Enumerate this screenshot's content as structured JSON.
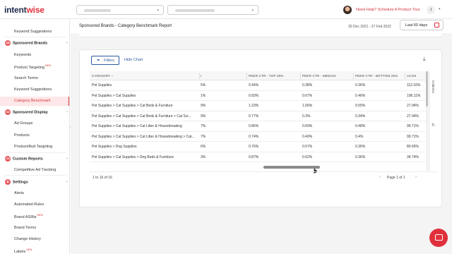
{
  "brand": {
    "logo_part1": "intent",
    "logo_part2": "wise"
  },
  "header": {
    "help_text": "Need Help? Schedule A Product Tour",
    "user_initial": "J",
    "colors": {
      "accent": "#e0303b",
      "link": "#2c5aa0"
    }
  },
  "sidebar": {
    "items": [
      {
        "label": "Keyword Suggestions"
      },
      {
        "section": "Sponsored Brands",
        "badge": "SB"
      },
      {
        "label": "Keywords"
      },
      {
        "label": "Product Targeting",
        "new": "NEW"
      },
      {
        "label": "Search Terms"
      },
      {
        "label": "Keyword Suggestions"
      },
      {
        "label": "Category Benchmark",
        "active": true
      },
      {
        "section": "Sponsored Display",
        "badge": "SD"
      },
      {
        "label": "Ad Groups"
      },
      {
        "label": "Products"
      },
      {
        "label": "Product/Aud Targeting"
      },
      {
        "section": "Custom Reports",
        "badge": "CR"
      },
      {
        "label": "Competitive Ad Tracking"
      },
      {
        "section": "Settings",
        "badge": "⚙"
      },
      {
        "label": "Alerts"
      },
      {
        "label": "Automated Rules"
      },
      {
        "label": "Brand ASINs",
        "new": "NEW"
      },
      {
        "label": "Brand Terms"
      },
      {
        "label": "Change History"
      },
      {
        "label": "Labels",
        "new": "NEW"
      }
    ]
  },
  "page": {
    "title": "Sponsored Brands - Category Benchmark Report",
    "date_range": "30 Dec 2021 - 27 Feb 2022",
    "date_button": "Last 60 days"
  },
  "toolbar": {
    "filters_label": "Filters",
    "hide_chart_label": "Hide Chart"
  },
  "table": {
    "columns": [
      "CATEGORY",
      "I",
      "PEER CTR - TOP 25%",
      "PEER CTR - MEDIAN",
      "PEER CTR - BOTTOM 25%",
      "ACOS"
    ],
    "rows": [
      [
        "Pet Supplies",
        "5%",
        "0.44%",
        "0.38%",
        "0.36%",
        "112.16%"
      ],
      [
        "Pet Supplies > Cat Supplies",
        "1%",
        "0.83%",
        "0.67%",
        "0.46%",
        "106.11%"
      ],
      [
        "Pet Supplies > Cat Supplies > Cat Beds & Furniture",
        "9%",
        "1.23%",
        "1.06%",
        "0.55%",
        "27.94%"
      ],
      [
        "Pet Supplies > Cat Supplies > Cat Beds & Furniture > Cat Scr...",
        "9%",
        "0.77%",
        "0.3%",
        "0.34%",
        "27.94%"
      ],
      [
        "Pet Supplies > Cat Supplies > Cat Litter & Housebreaking",
        "7%",
        "0.86%",
        "0.69%",
        "0.48%",
        "99.71%"
      ],
      [
        "Pet Supplies > Cat Supplies > Cat Litter & Housebreaking > Cat...",
        "7%",
        "0.74%",
        "0.49%",
        "0.4%",
        "99.71%"
      ],
      [
        "Pet Supplies > Dog Supplies",
        "6%",
        "0.76%",
        "0.57%",
        "0.35%",
        "80.65%"
      ],
      [
        "Pet Supplies > Cat Supplies > Dog Beds & Furniture",
        "3%",
        "0.87%",
        "0.62%",
        "0.36%",
        "34.74%"
      ]
    ],
    "side_panel_label": "Columns",
    "row_count": "1 to 16 of 16",
    "pager": "Page 1 of 1"
  }
}
